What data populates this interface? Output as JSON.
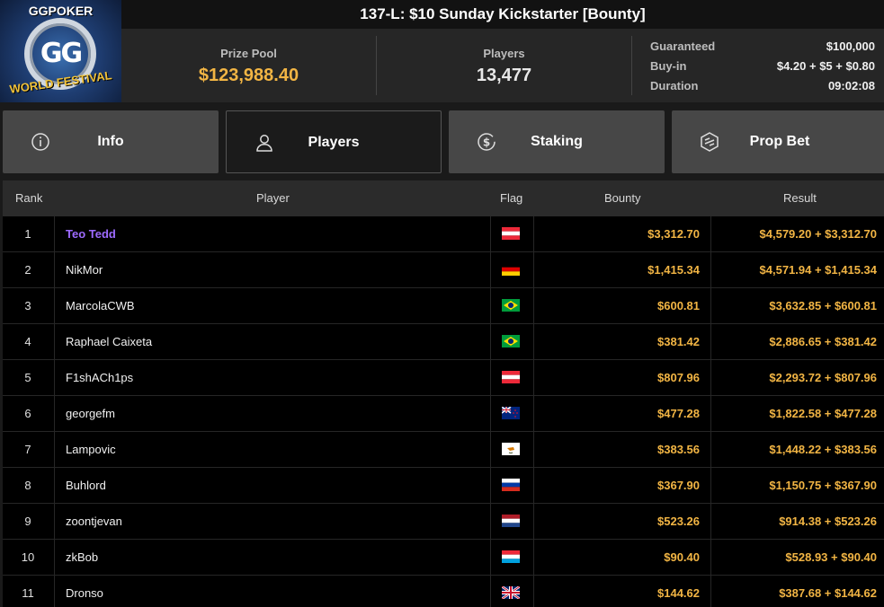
{
  "header": {
    "title": "137-L: $10 Sunday Kickstarter [Bounty]",
    "logo": {
      "top_text": "GGPOKER",
      "center_text": "GG",
      "bottom_text": "WORLD FESTIVAL"
    },
    "prize_pool": {
      "label": "Prize Pool",
      "value": "$123,988.40"
    },
    "players": {
      "label": "Players",
      "value": "13,477"
    },
    "details": [
      {
        "label": "Guaranteed",
        "value": "$100,000"
      },
      {
        "label": "Buy-in",
        "value": "$4.20 + $5 + $0.80"
      },
      {
        "label": "Duration",
        "value": "09:02:08"
      }
    ]
  },
  "tabs": [
    {
      "label": "Info",
      "icon": "info-icon",
      "active": false
    },
    {
      "label": "Players",
      "icon": "user-icon",
      "active": true
    },
    {
      "label": "Staking",
      "icon": "staking-icon",
      "active": false
    },
    {
      "label": "Prop Bet",
      "icon": "prop-bet-icon",
      "active": false
    }
  ],
  "table": {
    "columns": {
      "rank": "Rank",
      "player": "Player",
      "flag": "Flag",
      "bounty": "Bounty",
      "result": "Result"
    },
    "rows": [
      {
        "rank": "1",
        "player": "Teo Tedd",
        "flag": "austria",
        "bounty": "$3,312.70",
        "result": "$4,579.20 + $3,312.70"
      },
      {
        "rank": "2",
        "player": "NikMor",
        "flag": "germany",
        "bounty": "$1,415.34",
        "result": "$4,571.94 + $1,415.34"
      },
      {
        "rank": "3",
        "player": "MarcolaCWB",
        "flag": "brazil",
        "bounty": "$600.81",
        "result": "$3,632.85 + $600.81"
      },
      {
        "rank": "4",
        "player": "Raphael Caixeta",
        "flag": "brazil",
        "bounty": "$381.42",
        "result": "$2,886.65 + $381.42"
      },
      {
        "rank": "5",
        "player": "F1shACh1ps",
        "flag": "austria",
        "bounty": "$807.96",
        "result": "$2,293.72 + $807.96"
      },
      {
        "rank": "6",
        "player": "georgefm",
        "flag": "new-zealand",
        "bounty": "$477.28",
        "result": "$1,822.58 + $477.28"
      },
      {
        "rank": "7",
        "player": "Lampovic",
        "flag": "cyprus",
        "bounty": "$383.56",
        "result": "$1,448.22 + $383.56"
      },
      {
        "rank": "8",
        "player": "Buhlord",
        "flag": "russia",
        "bounty": "$367.90",
        "result": "$1,150.75 + $367.90"
      },
      {
        "rank": "9",
        "player": "zoontjevan",
        "flag": "netherlands",
        "bounty": "$523.26",
        "result": "$914.38 + $523.26"
      },
      {
        "rank": "10",
        "player": "zkBob",
        "flag": "luxembourg",
        "bounty": "$90.40",
        "result": "$528.93 + $90.40"
      },
      {
        "rank": "11",
        "player": "Dronso",
        "flag": "united-kingdom",
        "bounty": "$144.62",
        "result": "$387.68 + $144.62"
      }
    ]
  },
  "colors": {
    "accent_gold": "#f2b544",
    "winner_purple": "#9d6bff",
    "tab_bg": "#474747"
  }
}
